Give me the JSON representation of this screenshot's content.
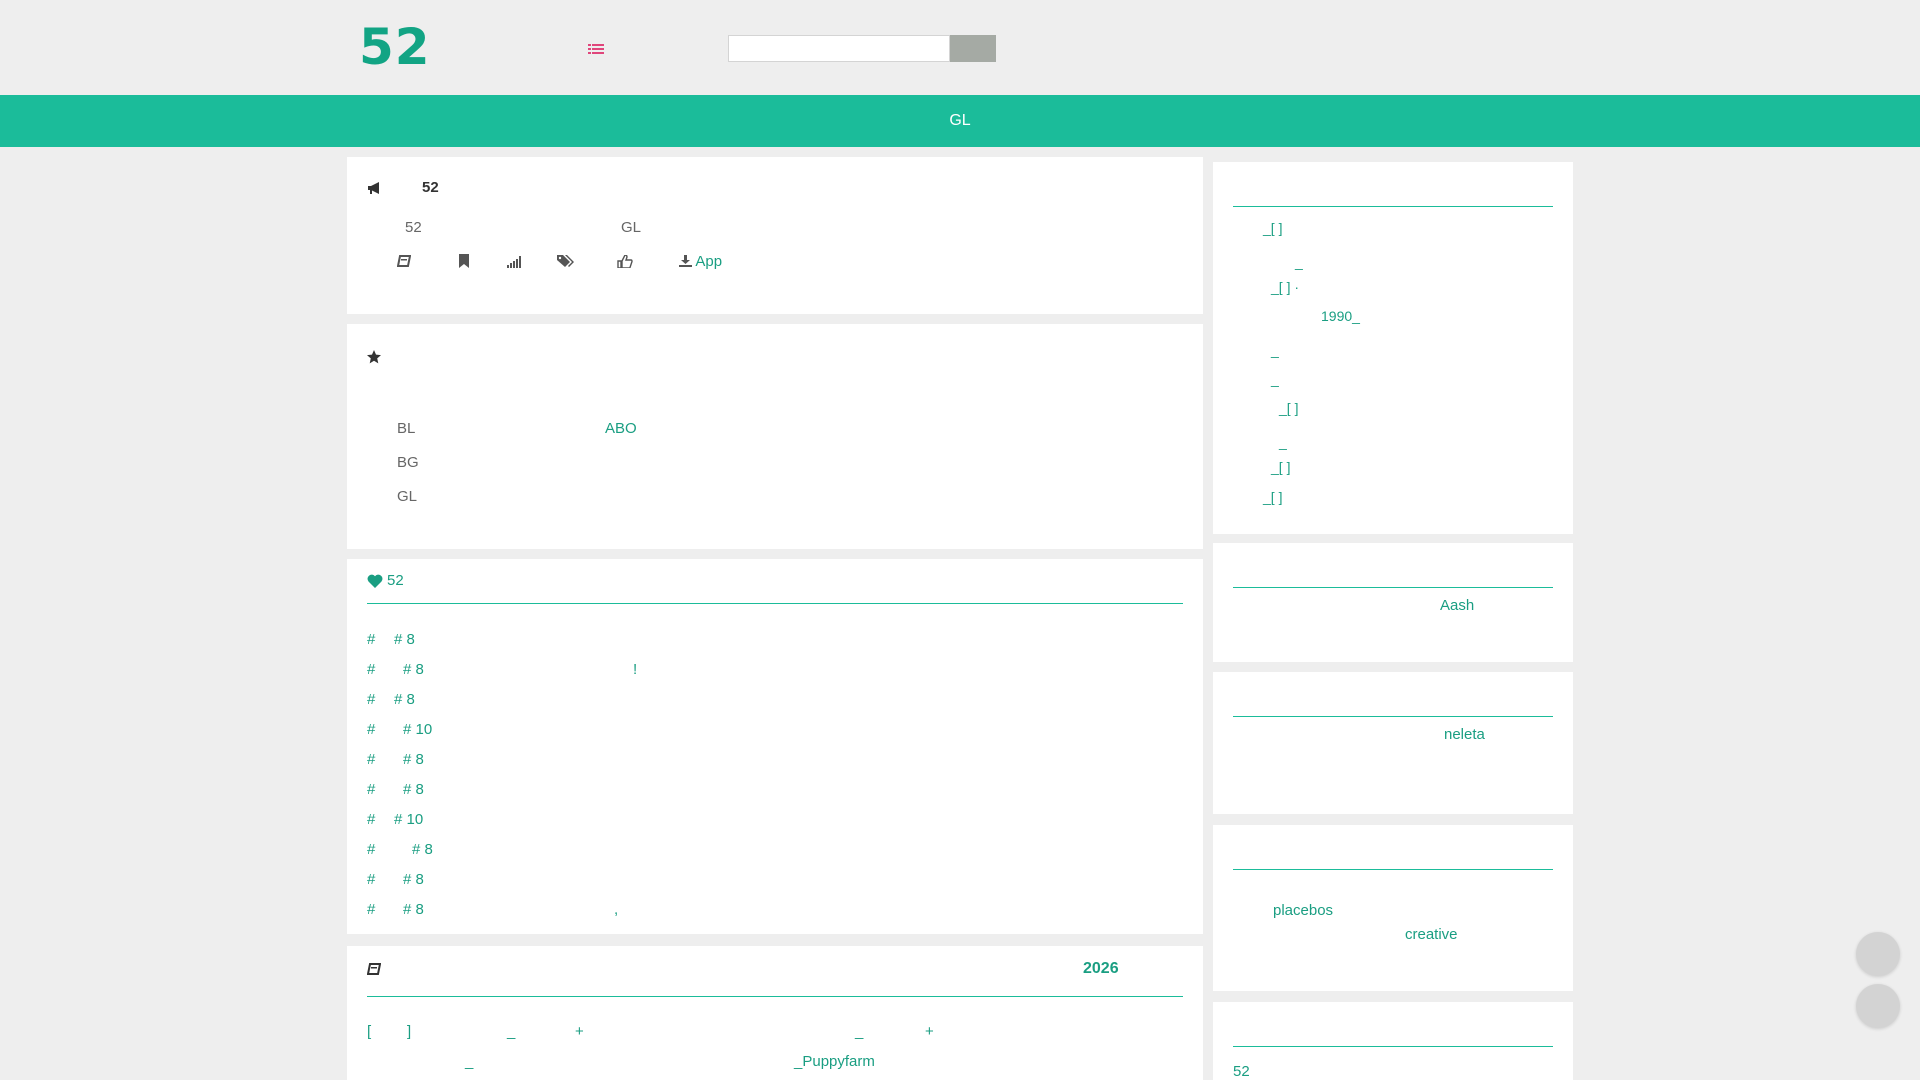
{
  "header": {
    "logo": "52",
    "search_placeholder": "",
    "search_button_label": ""
  },
  "nav": {
    "item": "GL"
  },
  "info": {
    "title": "52",
    "meta_left": "52",
    "meta_right": "GL",
    "download_label": "App"
  },
  "recommend": {
    "rows": [
      {
        "tag": "BL",
        "link": "ABO"
      },
      {
        "tag": "BG",
        "link": ""
      },
      {
        "tag": "GL",
        "link": ""
      }
    ]
  },
  "chapters": {
    "heading": "52",
    "items": [
      {
        "hash": "#",
        "label": "# 8",
        "extra": ""
      },
      {
        "hash": "#",
        "label": "# 8",
        "extra": "!"
      },
      {
        "hash": "#",
        "label": "# 8",
        "extra": ""
      },
      {
        "hash": "#",
        "label": "# 10",
        "extra": ""
      },
      {
        "hash": "#",
        "label": "# 8",
        "extra": ""
      },
      {
        "hash": "#",
        "label": "# 8",
        "extra": ""
      },
      {
        "hash": "#",
        "label": "# 10",
        "extra": ""
      },
      {
        "hash": "#",
        "label": "# 8",
        "extra": ""
      },
      {
        "hash": "#",
        "label": "# 8",
        "extra": ""
      },
      {
        "hash": "#",
        "label": "# 8",
        "extra": ","
      }
    ]
  },
  "books": {
    "year": "2026",
    "line1": [
      "[",
      "]",
      "_",
      "+",
      "_",
      "+"
    ],
    "line2": [
      "_",
      "_Puppyfarm"
    ]
  },
  "sidebar": {
    "box1": [
      "_[  ]",
      "_",
      "_[ ]   ·",
      "1990_",
      "_",
      "_",
      "_[ ]",
      "_",
      "_[ ]",
      "_[ ]"
    ],
    "box2": {
      "link": "Aash"
    },
    "box3": {
      "link": "neleta"
    },
    "box4": {
      "link1": "placebos",
      "link2": "creative"
    },
    "box5": {
      "link": "52"
    }
  },
  "colors": {
    "accent": "#1bbc9a",
    "link": "#1a9e82",
    "logo": "#12a484",
    "menu_icon": "#e0457b"
  }
}
